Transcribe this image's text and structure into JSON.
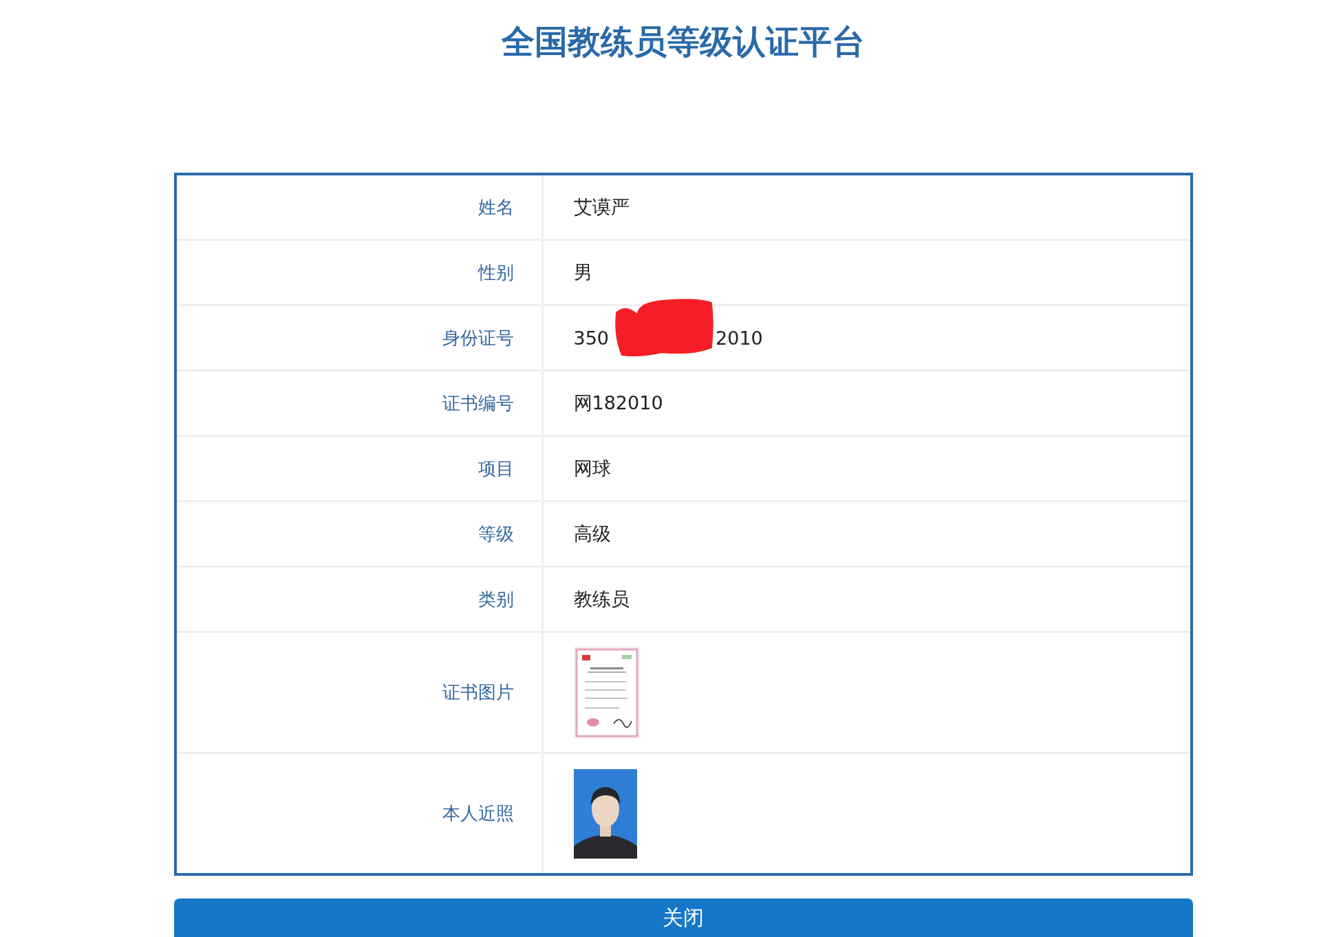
{
  "title": "全国教练员等级认证平台",
  "rows": [
    {
      "label": "姓名",
      "kind": "text",
      "value": "艾谟严"
    },
    {
      "label": "性别",
      "kind": "text",
      "value": "男"
    },
    {
      "label": "身份证号",
      "kind": "redacted",
      "parts": [
        "350",
        "2010"
      ]
    },
    {
      "label": "证书编号",
      "kind": "text",
      "value": "网182010"
    },
    {
      "label": "项目",
      "kind": "text",
      "value": "网球"
    },
    {
      "label": "等级",
      "kind": "text",
      "value": "高级"
    },
    {
      "label": "类别",
      "kind": "text",
      "value": "教练员"
    },
    {
      "label": "证书图片",
      "kind": "document"
    },
    {
      "label": "本人近照"
    }
  ],
  "close_button": "关闭"
}
